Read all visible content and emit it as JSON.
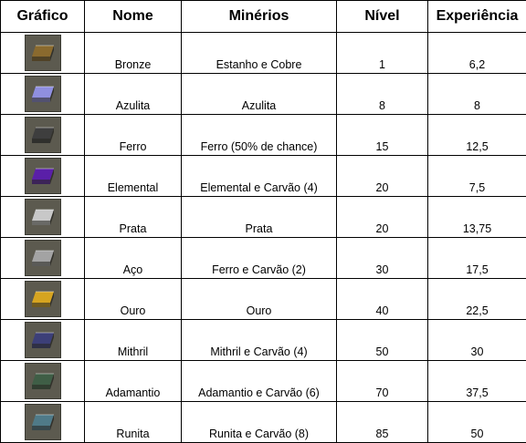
{
  "headers": [
    "Gráfico",
    "Nome",
    "Minérios",
    "Nível",
    "Experiência"
  ],
  "rows": [
    {
      "icon": "bronze-bar-icon",
      "color": "#8a6a2e",
      "name": "Bronze",
      "ores": "Estanho e Cobre",
      "level": "1",
      "xp": "6,2"
    },
    {
      "icon": "blurite-bar-icon",
      "color": "#8f8fe0",
      "name": "Azulita",
      "ores": "Azulita",
      "level": "8",
      "xp": "8"
    },
    {
      "icon": "iron-bar-icon",
      "color": "#3e3e3e",
      "name": "Ferro",
      "ores": "Ferro (50% de chance)",
      "level": "15",
      "xp": "12,5"
    },
    {
      "icon": "elemental-bar-icon",
      "color": "#5a1fa8",
      "name": "Elemental",
      "ores": "Elemental e Carvão (4)",
      "level": "20",
      "xp": "7,5"
    },
    {
      "icon": "silver-bar-icon",
      "color": "#c8c8c8",
      "name": "Prata",
      "ores": "Prata",
      "level": "20",
      "xp": "13,75"
    },
    {
      "icon": "steel-bar-icon",
      "color": "#a3a3a3",
      "name": "Aço",
      "ores": "Ferro e Carvão (2)",
      "level": "30",
      "xp": "17,5"
    },
    {
      "icon": "gold-bar-icon",
      "color": "#d6a420",
      "name": "Ouro",
      "ores": "Ouro",
      "level": "40",
      "xp": "22,5"
    },
    {
      "icon": "mithril-bar-icon",
      "color": "#3c3f78",
      "name": "Mithril",
      "ores": "Mithril e Carvão (4)",
      "level": "50",
      "xp": "30"
    },
    {
      "icon": "adamantite-bar-icon",
      "color": "#3f5e46",
      "name": "Adamantio",
      "ores": "Adamantio e Carvão (6)",
      "level": "70",
      "xp": "37,5"
    },
    {
      "icon": "runite-bar-icon",
      "color": "#4f7a88",
      "name": "Runita",
      "ores": "Runita e Carvão (8)",
      "level": "85",
      "xp": "50"
    }
  ]
}
